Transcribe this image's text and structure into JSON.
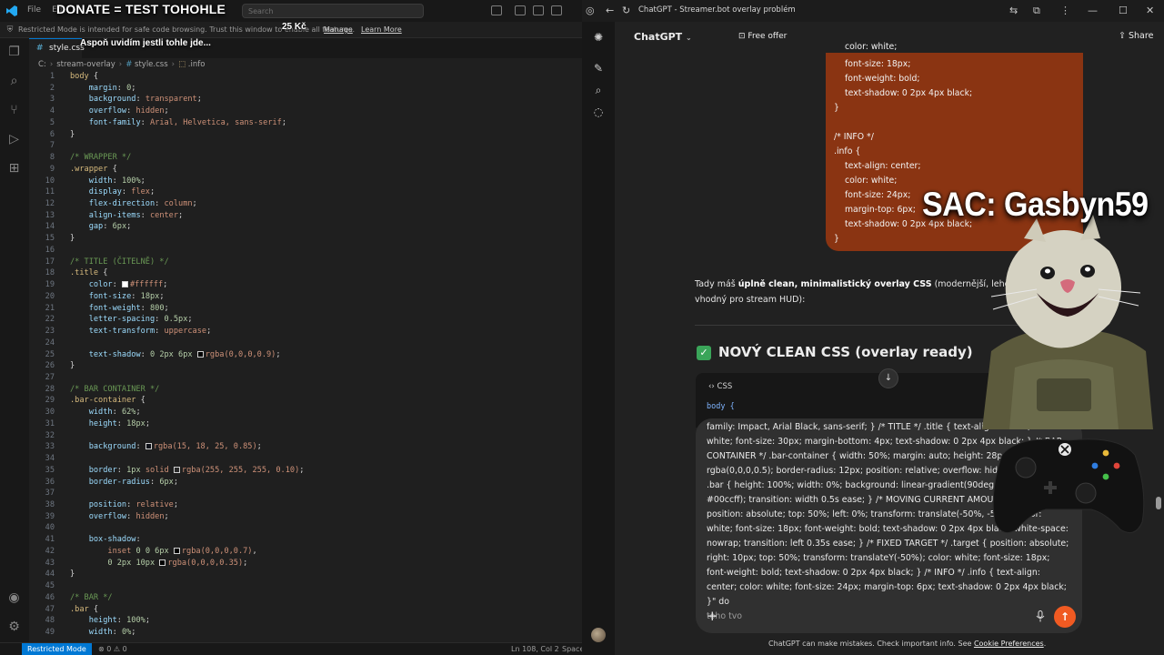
{
  "vscode": {
    "menu": [
      "File",
      "Ed"
    ],
    "search_placeholder": "Search",
    "restricted_banner": "Restricted Mode is intended for safe code browsing. Trust this window to enable all features.",
    "manage_link": "Manage",
    "learn_more_link": "Learn More",
    "tab_label": "style.css",
    "breadcrumb": [
      "C:",
      "stream-overlay",
      "style.css",
      ".info"
    ],
    "status": {
      "restricted_mode": "Restricted Mode",
      "errors": "0",
      "warnings": "0",
      "position": "Ln 108, Col 2",
      "spaces": "Spaces"
    }
  },
  "overlay": {
    "donate_title": "DONATE = TEST TOHOHLE",
    "donate_amount": "25 Kč",
    "donate_message": "Aspoň uvidím jestli tohle jde...",
    "sac_label": "SAC: Gasbyn59"
  },
  "browser": {
    "tab_title": "ChatGPT - Streamer.bot overlay problém",
    "model_name": "ChatGPT",
    "free_offer": "Free offer",
    "share": "Share",
    "user_bubble_lines": [
      "color: white;",
      "font-size: 18px;",
      "font-weight: bold;",
      "text-shadow: 0 2px 4px black;",
      "}",
      "",
      "/* INFO */",
      ".info {",
      "text-align: center;",
      "color: white;",
      "font-size: 24px;",
      "margin-top: 6px;",
      "text-shadow: 0 2px 4px black;",
      "}"
    ],
    "response_intro_pre": "Tady máš ",
    "response_intro_bold": "úplně clean, minimalistický overlay CSS",
    "response_intro_post": " (modernější, lehčí, be",
    "response_intro_line2": "vhodný pro stream HUD):",
    "response_heading": "NOVÝ CLEAN CSS (overlay ready)",
    "code_lang": "CSS",
    "code_first_line": "body {",
    "composer_text": "family: Impact, Arial Black, sans-serif; } /* TITLE */ .title { text-align: center; color: white; font-size: 30px; margin-bottom: 4px; text-shadow: 0 2px 4px black; } /* BAR CONTAINER */ .bar-container { width: 50%; margin: auto; height: 28px; background: rgba(0,0,0,0.5); border-radius: 12px; position: relative; overflow: hidden; } /* BAR */ .bar { height: 100%; width: 0%; background: linear-gradient(90deg, #00ff88, #00ccff); transition: width 0.5s ease; } /* MOVING CURRENT AMOUNT */ .current { position: absolute; top: 50%; left: 0%; transform: translate(-50%, -50%); color: white; font-size: 18px; font-weight: bold; text-shadow: 0 2px 4px black; white-space: nowrap; transition: left 0.35s ease; } /* FIXED TARGET */ .target { position: absolute; right: 10px; top: 50%; transform: translateY(-50%); color: white; font-size: 18px; font-weight: bold; text-shadow: 0 2px 4px black; } /* INFO */ .info { text-align: center; color: white; font-size: 24px; margin-top: 6px; text-shadow: 0 2px 4px black; }\" do",
    "composer_tail": "toho tvo",
    "disclaimer_pre": "ChatGPT can make mistakes. Check important info. See ",
    "disclaimer_link": "Cookie Preferences",
    "disclaimer_post": "."
  }
}
